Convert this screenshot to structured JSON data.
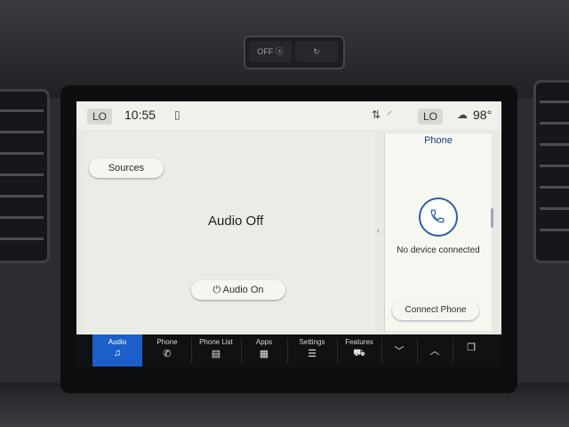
{
  "hardware": {
    "button_a_label": "OFF ⓐ",
    "button_b_label": "↻"
  },
  "status_bar": {
    "left_lo": "LO",
    "time": "10:55",
    "right_lo": "LO",
    "temperature": "98°"
  },
  "audio": {
    "sources_label": "Sources",
    "status_text": "Audio Off",
    "audio_on_label": "Audio On"
  },
  "phone": {
    "title": "Phone",
    "message": "No device connected",
    "connect_label": "Connect Phone"
  },
  "nav": {
    "items": [
      {
        "label": "Audio",
        "icon": "music-note-icon",
        "glyph": "♫"
      },
      {
        "label": "Phone",
        "icon": "phone-icon",
        "glyph": "✆"
      },
      {
        "label": "Phone List",
        "icon": "phone-list-icon",
        "glyph": "▤"
      },
      {
        "label": "Apps",
        "icon": "apps-grid-icon",
        "glyph": "▦"
      },
      {
        "label": "Settings",
        "icon": "settings-sliders-icon",
        "glyph": "☰"
      },
      {
        "label": "Features",
        "icon": "truck-icon",
        "glyph": "⛟"
      }
    ],
    "chevron_down": "﹀",
    "chevron_up": "︿",
    "window_icon": "❐"
  },
  "colors": {
    "accent": "#1c5fc9",
    "phone_ring": "#2b5ea8",
    "nav_bg": "#101113",
    "screen_bg": "#e9e9e3"
  }
}
